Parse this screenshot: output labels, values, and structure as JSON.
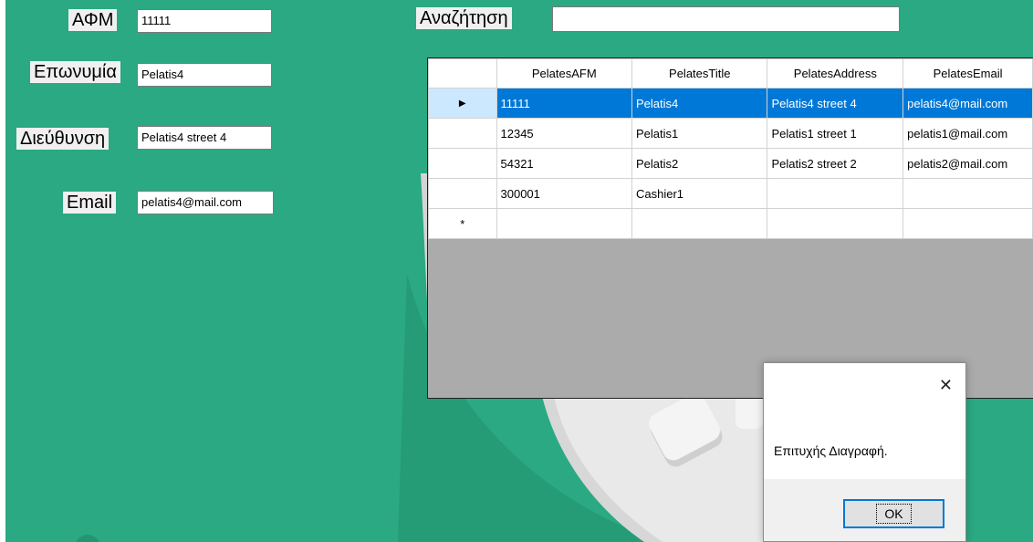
{
  "form": {
    "afm_label": "ΑΦΜ",
    "afm_value": "11111",
    "surname_label": "Επωνυμία",
    "surname_value": "Pelatis4",
    "address_label": "Διεύθυνση",
    "address_value": "Pelatis4 street 4",
    "email_label": "Email",
    "email_value": "pelatis4@mail.com",
    "search_label": "Αναζήτηση",
    "search_value": ""
  },
  "grid": {
    "columns": [
      "PelatesAFM",
      "PelatesTitle",
      "PelatesAddress",
      "PelatesEmail"
    ],
    "rows": [
      [
        "11111",
        "Pelatis4",
        "Pelatis4 street 4",
        "pelatis4@mail.com"
      ],
      [
        "12345",
        "Pelatis1",
        "Pelatis1 street 1",
        "pelatis1@mail.com"
      ],
      [
        "54321",
        "Pelatis2",
        "Pelatis2 street 2",
        "pelatis2@mail.com"
      ],
      [
        "300001",
        "Cashier1",
        "",
        ""
      ]
    ],
    "selected_marker": "▶",
    "new_row_marker": "*"
  },
  "dialog": {
    "message": "Επιτυχής Διαγραφή.",
    "ok_label": "OK",
    "close_glyph": "✕"
  },
  "colors": {
    "background": "#2aa982",
    "selection": "#0078d7",
    "grid_empty": "#ababab"
  }
}
